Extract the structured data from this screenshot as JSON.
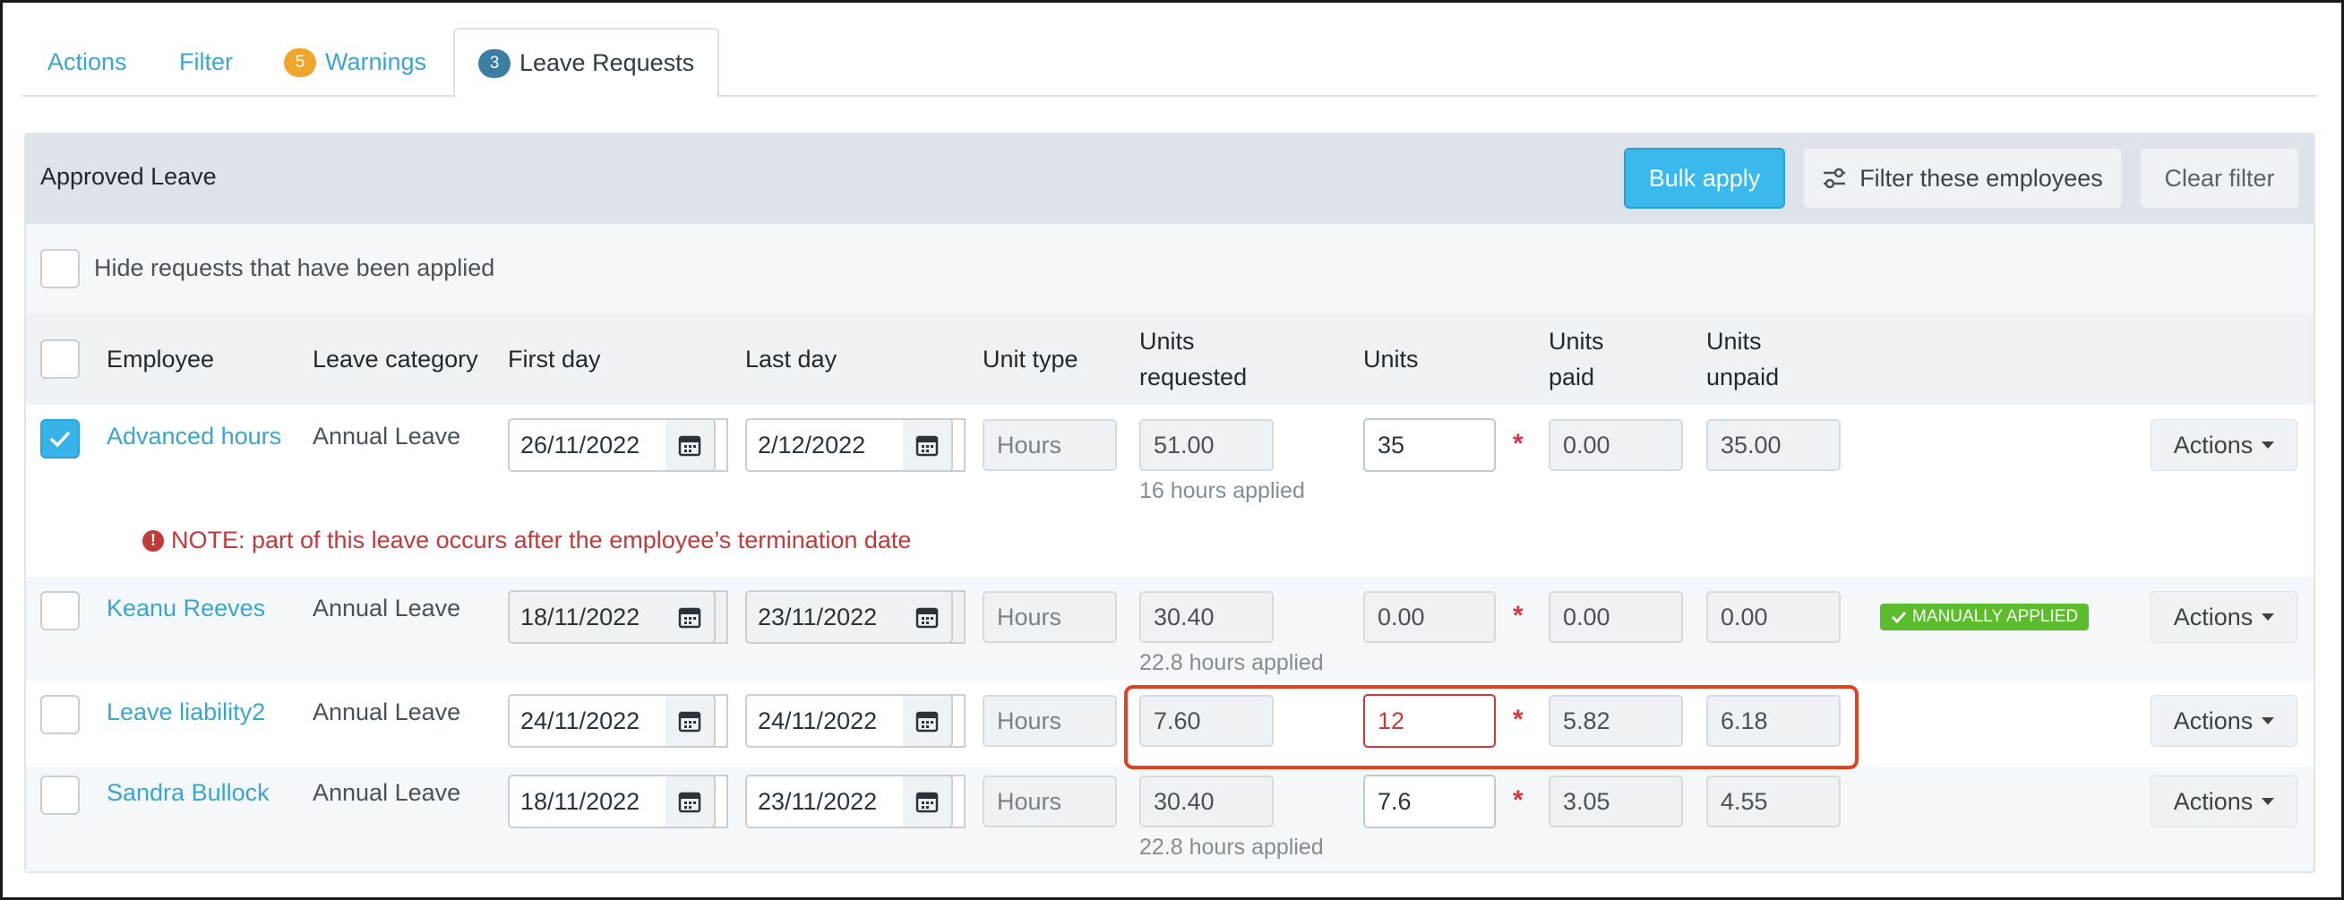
{
  "tabs": [
    {
      "label": "Actions"
    },
    {
      "label": "Filter"
    },
    {
      "label": "Warnings",
      "count": "5"
    },
    {
      "label": "Leave Requests",
      "count": "3"
    }
  ],
  "panel": {
    "title": "Approved Leave",
    "bulk_apply": "Bulk apply",
    "filter_employees": "Filter these employees",
    "clear_filter": "Clear filter",
    "hide_applied_label": "Hide requests that have been applied"
  },
  "columns": {
    "employee": "Employee",
    "leave_category": "Leave category",
    "first_day": "First day",
    "last_day": "Last day",
    "unit_type": "Unit type",
    "units_requested_1": "Units",
    "units_requested_2": "requested",
    "units": "Units",
    "units_paid_1": "Units",
    "units_paid_2": "paid",
    "units_unpaid_1": "Units",
    "units_unpaid_2": "unpaid"
  },
  "rows": [
    {
      "employee": "Advanced hours",
      "category": "Annual Leave",
      "first_day": "26/11/2022",
      "last_day": "2/12/2022",
      "unit_type": "Hours",
      "units_requested": "51.00",
      "applied_note": "16 hours applied",
      "units": "35",
      "units_paid": "0.00",
      "units_unpaid": "35.00",
      "actions": "Actions",
      "note": "NOTE: part of this leave occurs after the employee’s termination date"
    },
    {
      "employee": "Keanu Reeves",
      "category": "Annual Leave",
      "first_day": "18/11/2022",
      "last_day": "23/11/2022",
      "unit_type": "Hours",
      "units_requested": "30.40",
      "applied_note": "22.8 hours applied",
      "units": "0.00",
      "units_paid": "0.00",
      "units_unpaid": "0.00",
      "status_badge": "MANUALLY APPLIED",
      "actions": "Actions"
    },
    {
      "employee": "Leave liability2",
      "category": "Annual Leave",
      "first_day": "24/11/2022",
      "last_day": "24/11/2022",
      "unit_type": "Hours",
      "units_requested": "7.60",
      "units": "12",
      "units_paid": "5.82",
      "units_unpaid": "6.18",
      "actions": "Actions"
    },
    {
      "employee": "Sandra Bullock",
      "category": "Annual Leave",
      "first_day": "18/11/2022",
      "last_day": "23/11/2022",
      "unit_type": "Hours",
      "units_requested": "30.40",
      "applied_note": "22.8 hours applied",
      "units": "7.6",
      "units_paid": "3.05",
      "units_unpaid": "4.55",
      "actions": "Actions"
    }
  ],
  "required_marker": "*",
  "colors": {
    "accent": "#39b9ec",
    "link": "#3aa6cf",
    "error": "#cc3a3a",
    "success": "#5cbd2c",
    "warning_badge": "#f0a62a",
    "highlight": "#e0421f"
  }
}
